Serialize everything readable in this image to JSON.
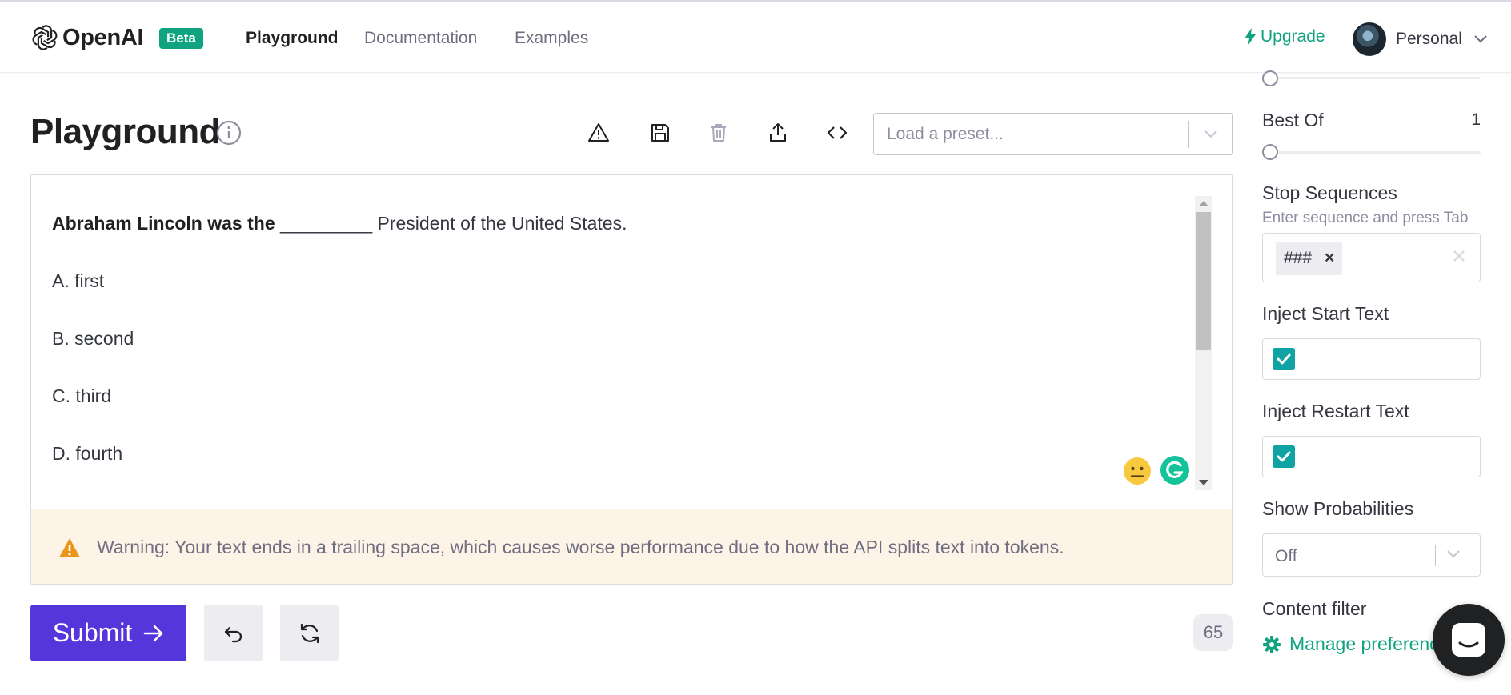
{
  "nav": {
    "brand": "OpenAI",
    "badge": "Beta",
    "links": [
      "Playground",
      "Documentation",
      "Examples"
    ],
    "upgrade": "Upgrade",
    "account": "Personal"
  },
  "header": {
    "title": "Playground",
    "preset_placeholder": "Load a preset..."
  },
  "editor": {
    "lines": [
      {
        "bold": "Abraham Lincoln was the ",
        "text": "_________ President of the United States."
      },
      {
        "bold": "",
        "text": "A. first"
      },
      {
        "bold": "",
        "text": "B. second"
      },
      {
        "bold": "",
        "text": "C. third"
      },
      {
        "bold": "",
        "text": "D. fourth"
      }
    ],
    "warning": "Warning: Your text ends in a trailing space, which causes worse performance due to how the API splits text into tokens."
  },
  "actions": {
    "submit": "Submit",
    "token_count": "65"
  },
  "settings": {
    "best_of": {
      "label": "Best Of",
      "value": "1"
    },
    "stop_sequences": {
      "label": "Stop Sequences",
      "hint": "Enter sequence and press Tab",
      "tags": [
        "###"
      ]
    },
    "inject_start": {
      "label": "Inject Start Text",
      "checked": true
    },
    "inject_restart": {
      "label": "Inject Restart Text",
      "checked": true
    },
    "show_probabilities": {
      "label": "Show Probabilities",
      "value": "Off"
    },
    "content_filter": {
      "label": "Content filter",
      "link": "Manage preferences"
    }
  },
  "colors": {
    "accent": "#10a37f",
    "submit": "#5436da",
    "checkbox": "#10a3a3",
    "warning_bg": "#fdf3e7",
    "warning_icon": "#e8961c"
  }
}
